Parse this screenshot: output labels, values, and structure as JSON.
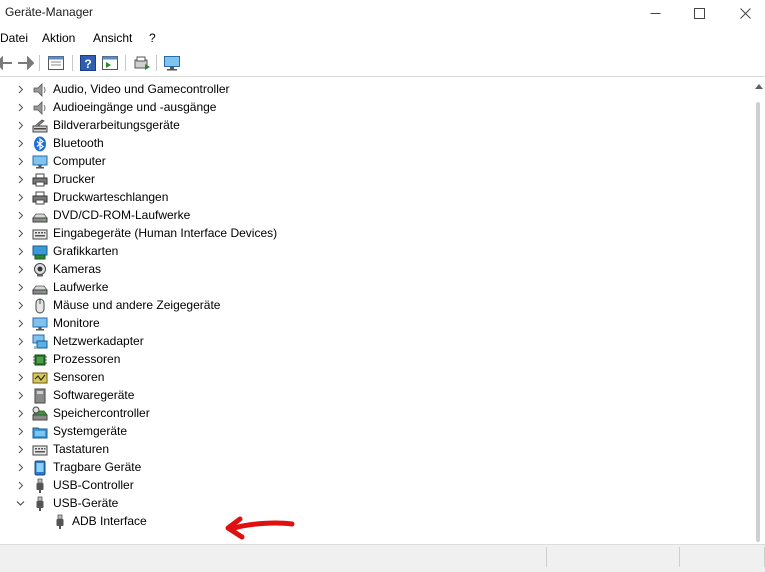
{
  "window": {
    "title": "Geräte-Manager"
  },
  "menu": [
    "Datei",
    "Aktion",
    "Ansicht",
    "?"
  ],
  "tree": [
    {
      "label": "Audio, Video und Gamecontroller",
      "icon": "speaker-icon"
    },
    {
      "label": "Audioeingänge und -ausgänge",
      "icon": "speaker-icon"
    },
    {
      "label": "Bildverarbeitungsgeräte",
      "icon": "scanner-icon"
    },
    {
      "label": "Bluetooth",
      "icon": "bluetooth-icon"
    },
    {
      "label": "Computer",
      "icon": "monitor-icon"
    },
    {
      "label": "Drucker",
      "icon": "printer-icon"
    },
    {
      "label": "Druckwarteschlangen",
      "icon": "printer-icon"
    },
    {
      "label": "DVD/CD-ROM-Laufwerke",
      "icon": "drive-icon"
    },
    {
      "label": "Eingabegeräte (Human Interface Devices)",
      "icon": "keyboard-icon"
    },
    {
      "label": "Grafikkarten",
      "icon": "display-adapter-icon"
    },
    {
      "label": "Kameras",
      "icon": "camera-icon"
    },
    {
      "label": "Laufwerke",
      "icon": "drive-icon"
    },
    {
      "label": "Mäuse und andere Zeigegeräte",
      "icon": "mouse-icon"
    },
    {
      "label": "Monitore",
      "icon": "monitor-icon"
    },
    {
      "label": "Netzwerkadapter",
      "icon": "network-icon"
    },
    {
      "label": "Prozessoren",
      "icon": "chip-icon"
    },
    {
      "label": "Sensoren",
      "icon": "sensor-icon"
    },
    {
      "label": "Softwaregeräte",
      "icon": "software-device-icon"
    },
    {
      "label": "Speichercontroller",
      "icon": "storage-controller-icon"
    },
    {
      "label": "Systemgeräte",
      "icon": "system-folder-icon"
    },
    {
      "label": "Tastaturen",
      "icon": "keyboard-icon"
    },
    {
      "label": "Tragbare Geräte",
      "icon": "portable-device-icon"
    },
    {
      "label": "USB-Controller",
      "icon": "usb-icon"
    },
    {
      "label": "USB-Geräte",
      "icon": "usb-icon",
      "expanded": true
    },
    {
      "label": "ADB Interface",
      "icon": "usb-icon",
      "child": true
    }
  ]
}
